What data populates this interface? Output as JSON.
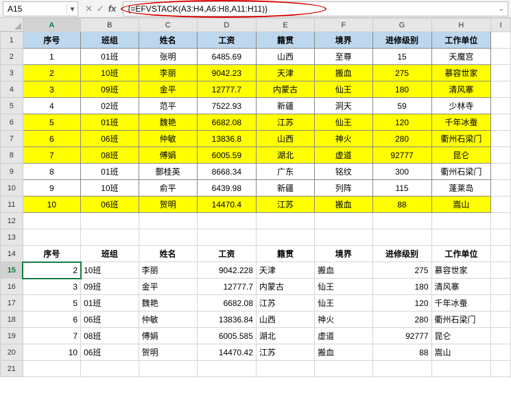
{
  "namebox": "A15",
  "formula": "{=EFVSTACK(A3:H4,A6:H8,A11:H11)}",
  "columns": [
    "A",
    "B",
    "C",
    "D",
    "E",
    "F",
    "G",
    "H",
    "I"
  ],
  "row_count": 21,
  "header_row": {
    "xuhao": "序号",
    "banzu": "班组",
    "xingming": "姓名",
    "gongzi": "工资",
    "jiguan": "籍贯",
    "jingjie": "境界",
    "jibie": "进修级别",
    "danwei": "工作单位"
  },
  "data_rows": [
    {
      "r": 2,
      "yl": false,
      "xuhao": "1",
      "banzu": "01班",
      "xingming": "张明",
      "gongzi": "6485.69",
      "jiguan": "山西",
      "jingjie": "至尊",
      "jibie": "15",
      "danwei": "天魔宫"
    },
    {
      "r": 3,
      "yl": true,
      "xuhao": "2",
      "banzu": "10班",
      "xingming": "李丽",
      "gongzi": "9042.23",
      "jiguan": "天津",
      "jingjie": "搬血",
      "jibie": "275",
      "danwei": "慕容世家"
    },
    {
      "r": 4,
      "yl": true,
      "xuhao": "3",
      "banzu": "09班",
      "xingming": "金平",
      "gongzi": "12777.7",
      "jiguan": "内蒙古",
      "jingjie": "仙王",
      "jibie": "180",
      "danwei": "清风寨"
    },
    {
      "r": 5,
      "yl": false,
      "xuhao": "4",
      "banzu": "02班",
      "xingming": "范平",
      "gongzi": "7522.93",
      "jiguan": "新疆",
      "jingjie": "洞天",
      "jibie": "59",
      "danwei": "少林寺"
    },
    {
      "r": 6,
      "yl": true,
      "xuhao": "5",
      "banzu": "01班",
      "xingming": "魏艳",
      "gongzi": "6682.08",
      "jiguan": "江苏",
      "jingjie": "仙王",
      "jibie": "120",
      "danwei": "千年冰蚕"
    },
    {
      "r": 7,
      "yl": true,
      "xuhao": "6",
      "banzu": "06班",
      "xingming": "仲敏",
      "gongzi": "13836.8",
      "jiguan": "山西",
      "jingjie": "神火",
      "jibie": "280",
      "danwei": "衢州石梁门"
    },
    {
      "r": 8,
      "yl": true,
      "xuhao": "7",
      "banzu": "08班",
      "xingming": "傅娟",
      "gongzi": "6005.59",
      "jiguan": "湖北",
      "jingjie": "虚道",
      "jibie": "92777",
      "danwei": "昆仑"
    },
    {
      "r": 9,
      "yl": false,
      "xuhao": "8",
      "banzu": "01班",
      "xingming": "酆桂英",
      "gongzi": "8668.34",
      "jiguan": "广东",
      "jingjie": "铭纹",
      "jibie": "300",
      "danwei": "衢州石梁门"
    },
    {
      "r": 10,
      "yl": false,
      "xuhao": "9",
      "banzu": "10班",
      "xingming": "俞平",
      "gongzi": "6439.98",
      "jiguan": "新疆",
      "jingjie": "列阵",
      "jibie": "115",
      "danwei": "蓬莱岛"
    },
    {
      "r": 11,
      "yl": true,
      "xuhao": "10",
      "banzu": "06班",
      "xingming": "贺明",
      "gongzi": "14470.4",
      "jiguan": "江苏",
      "jingjie": "搬血",
      "jibie": "88",
      "danwei": "嵩山"
    }
  ],
  "result_header_row": 14,
  "result_rows": [
    {
      "r": 15,
      "xuhao": "2",
      "banzu": "10班",
      "xingming": "李丽",
      "gongzi": "9042.228",
      "jiguan": "天津",
      "jingjie": "搬血",
      "jibie": "275",
      "danwei": "慕容世家"
    },
    {
      "r": 16,
      "xuhao": "3",
      "banzu": "09班",
      "xingming": "金平",
      "gongzi": "12777.7",
      "jiguan": "内蒙古",
      "jingjie": "仙王",
      "jibie": "180",
      "danwei": "清风寨"
    },
    {
      "r": 17,
      "xuhao": "5",
      "banzu": "01班",
      "xingming": "魏艳",
      "gongzi": "6682.08",
      "jiguan": "江苏",
      "jingjie": "仙王",
      "jibie": "120",
      "danwei": "千年冰蚕"
    },
    {
      "r": 18,
      "xuhao": "6",
      "banzu": "06班",
      "xingming": "仲敏",
      "gongzi": "13836.84",
      "jiguan": "山西",
      "jingjie": "神火",
      "jibie": "280",
      "danwei": "衢州石梁门"
    },
    {
      "r": 19,
      "xuhao": "7",
      "banzu": "08班",
      "xingming": "傅娟",
      "gongzi": "6005.585",
      "jiguan": "湖北",
      "jingjie": "虚道",
      "jibie": "92777",
      "danwei": "昆仑"
    },
    {
      "r": 20,
      "xuhao": "10",
      "banzu": "06班",
      "xingming": "贺明",
      "gongzi": "14470.42",
      "jiguan": "江苏",
      "jingjie": "搬血",
      "jibie": "88",
      "danwei": "嵩山"
    }
  ],
  "active_cell": {
    "row": 15,
    "col": "A"
  }
}
